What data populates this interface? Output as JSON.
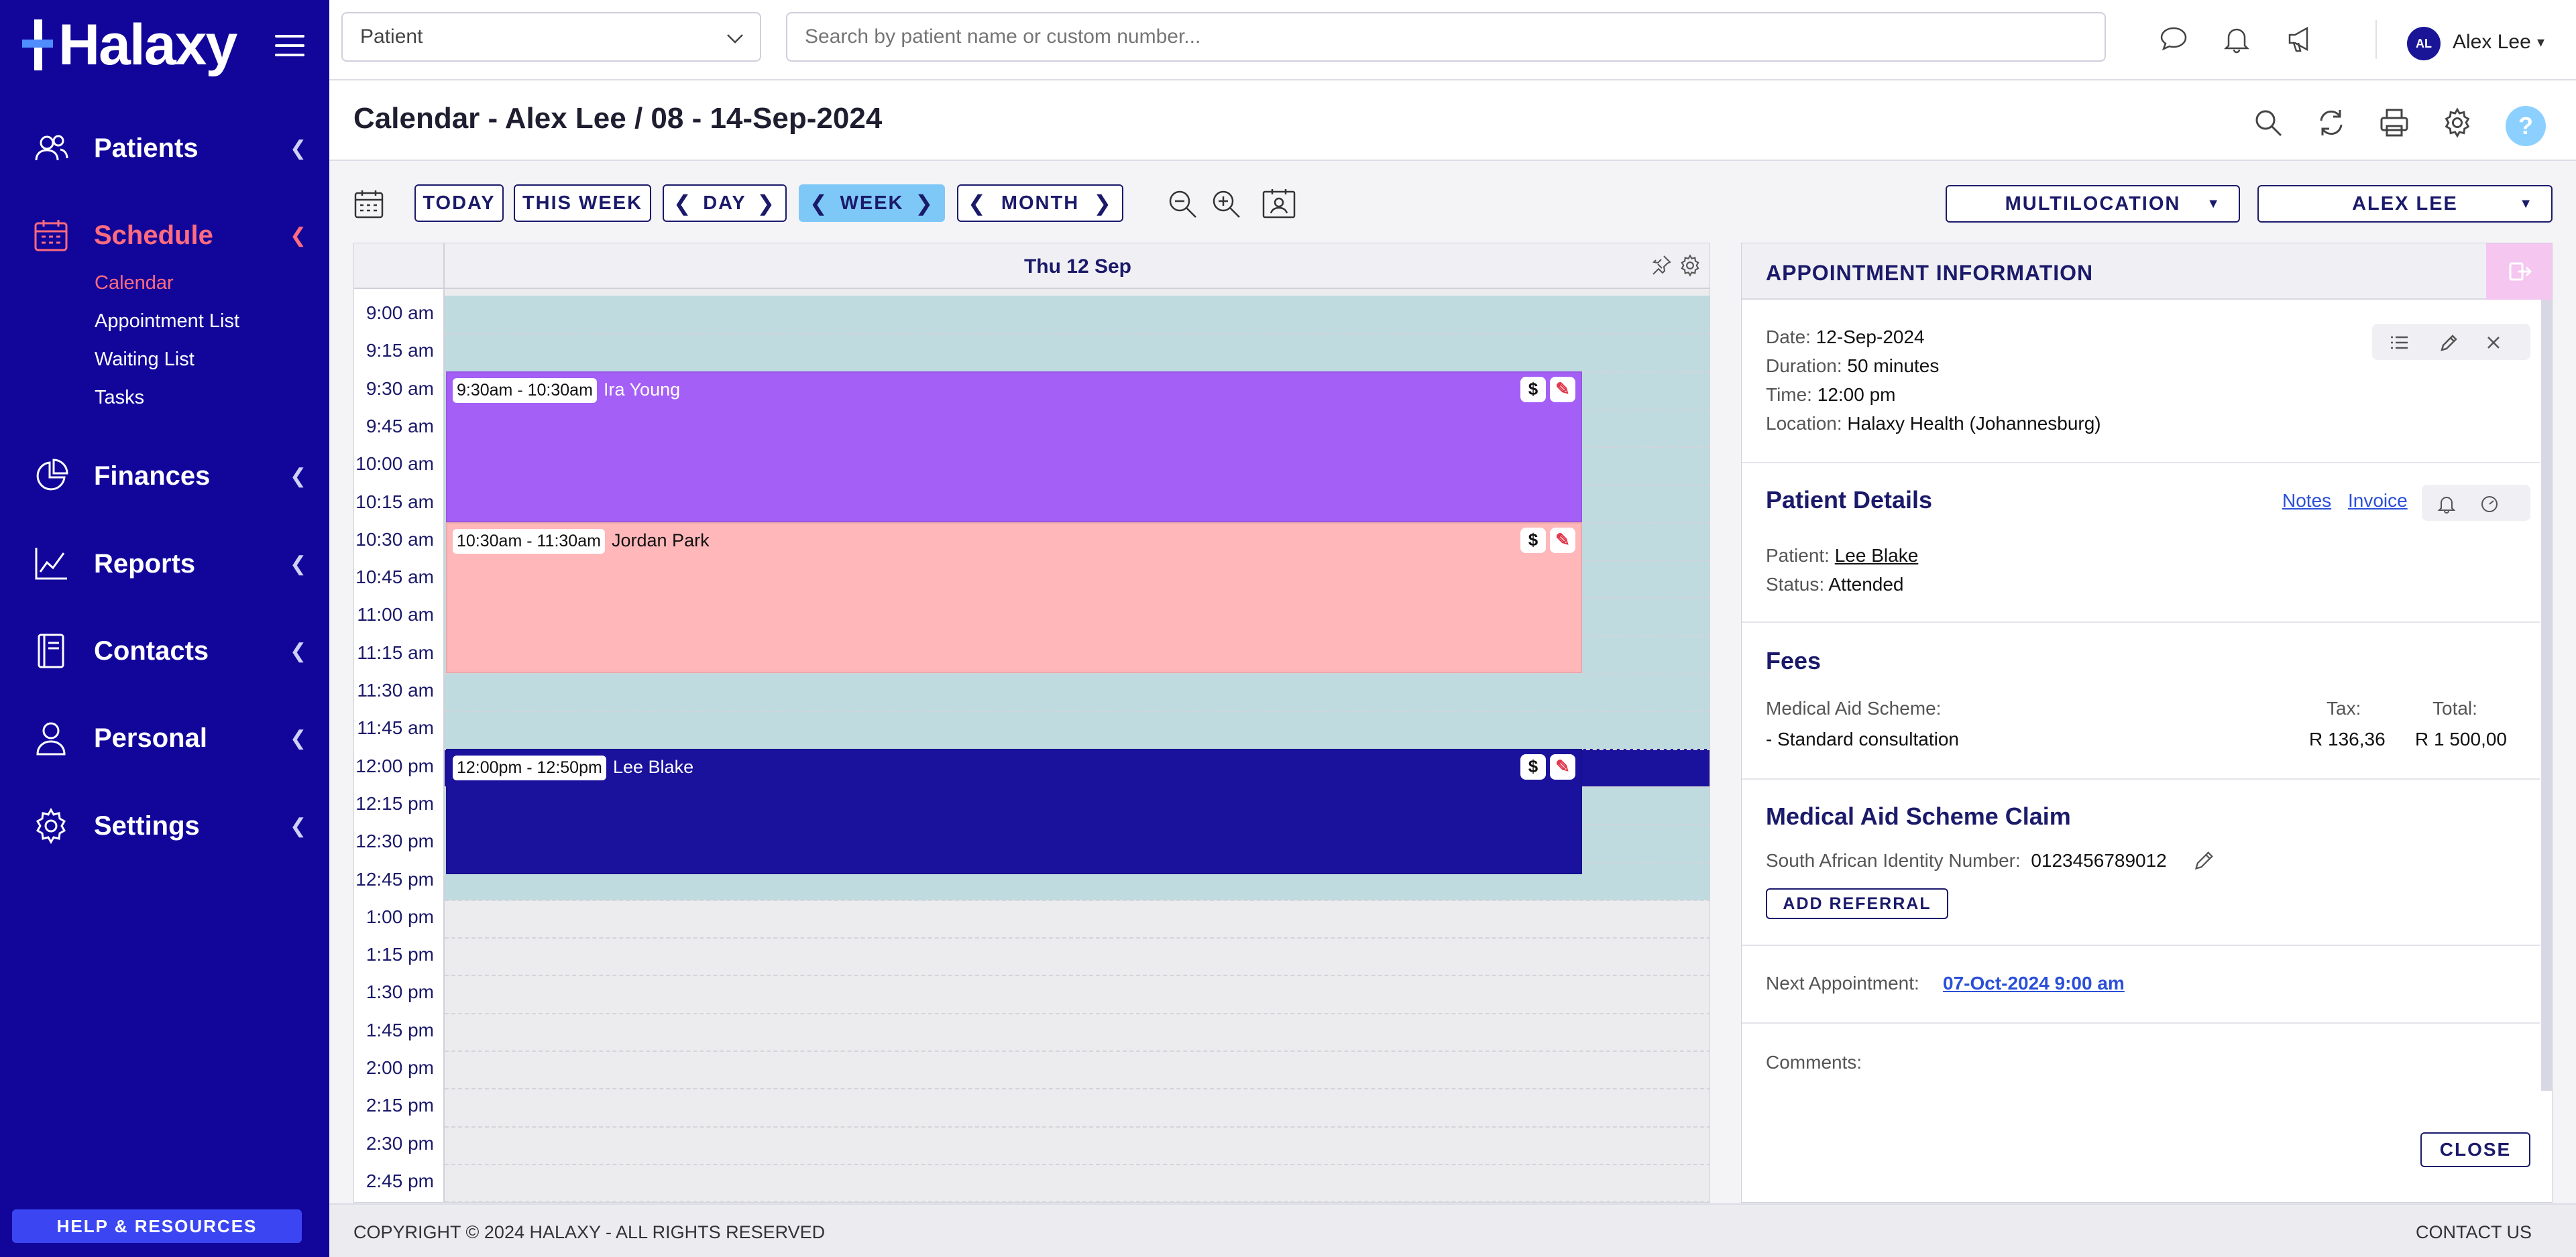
{
  "app": {
    "logo_text": "Halaxy"
  },
  "sidebar": {
    "nav": [
      {
        "label": "Patients",
        "icon": "users-icon"
      },
      {
        "label": "Schedule",
        "icon": "calendar-icon",
        "active": true
      },
      {
        "label": "Finances",
        "icon": "pie-chart-icon"
      },
      {
        "label": "Reports",
        "icon": "line-chart-icon"
      },
      {
        "label": "Contacts",
        "icon": "address-book-icon"
      },
      {
        "label": "Personal",
        "icon": "person-icon"
      },
      {
        "label": "Settings",
        "icon": "gear-icon"
      }
    ],
    "schedule_sub": [
      {
        "label": "Calendar",
        "active": true
      },
      {
        "label": "Appointment List"
      },
      {
        "label": "Waiting List"
      },
      {
        "label": "Tasks"
      }
    ],
    "help_button": "HELP & RESOURCES"
  },
  "topbar": {
    "patient_select": "Patient",
    "search_placeholder": "Search by patient name or custom number...",
    "user_initials": "AL",
    "user_name": "Alex Lee"
  },
  "header": {
    "title": "Calendar - Alex Lee / 08 - 14-Sep-2024"
  },
  "toolbar": {
    "today": "TODAY",
    "this_week": "THIS WEEK",
    "day": "DAY",
    "week": "WEEK",
    "month": "MONTH",
    "location_dropdown": "MULTILOCATION",
    "practitioner_dropdown": "ALEX LEE"
  },
  "calendar": {
    "day_label": "Thu 12 Sep",
    "times": [
      "9:00 am",
      "9:15 am",
      "9:30 am",
      "9:45 am",
      "10:00 am",
      "10:15 am",
      "10:30 am",
      "10:45 am",
      "11:00 am",
      "11:15 am",
      "11:30 am",
      "11:45 am",
      "12:00 pm",
      "12:15 pm",
      "12:30 pm",
      "12:45 pm",
      "1:00 pm",
      "1:15 pm",
      "1:30 pm",
      "1:45 pm",
      "2:00 pm",
      "2:15 pm",
      "2:30 pm",
      "2:45 pm"
    ],
    "appointments": [
      {
        "time": "9:30am - 10:30am",
        "patient": "Ira Young",
        "color": "#a45ff7",
        "text_color": "#ffffff"
      },
      {
        "time": "10:30am - 11:30am",
        "patient": "Jordan Park",
        "color": "#ffb7b9",
        "text_color": "#111111"
      },
      {
        "time": "12:00pm - 12:50pm",
        "patient": "Lee Blake",
        "color": "#1a119c",
        "text_color": "#ffffff"
      }
    ]
  },
  "info": {
    "title": "APPOINTMENT INFORMATION",
    "date_label": "Date:",
    "date": "12-Sep-2024",
    "duration_label": "Duration:",
    "duration": "50 minutes",
    "time_label": "Time:",
    "time": "12:00 pm",
    "location_label": "Location:",
    "location": "Halaxy Health (Johannesburg)",
    "patient_details_title": "Patient Details",
    "notes_link": "Notes",
    "invoice_link": "Invoice",
    "patient_label": "Patient:",
    "patient": "Lee Blake",
    "status_label": "Status:",
    "status": "Attended",
    "fees_title": "Fees",
    "scheme_label": "Medical Aid Scheme:",
    "tax_label": "Tax:",
    "total_label": "Total:",
    "fee_item": "- Standard consultation",
    "fee_tax": "R 136,36",
    "fee_total": "R 1 500,00",
    "claim_title": "Medical Aid Scheme Claim",
    "id_label": "South African Identity Number:",
    "id_number": "0123456789012",
    "add_referral": "ADD REFERRAL",
    "next_label": "Next Appointment:",
    "next_appt": "07-Oct-2024 9:00 am",
    "comments_label": "Comments:",
    "close": "CLOSE"
  },
  "footer": {
    "copyright": "COPYRIGHT © 2024 HALAXY - ALL RIGHTS RESERVED",
    "contact": "CONTACT US"
  }
}
